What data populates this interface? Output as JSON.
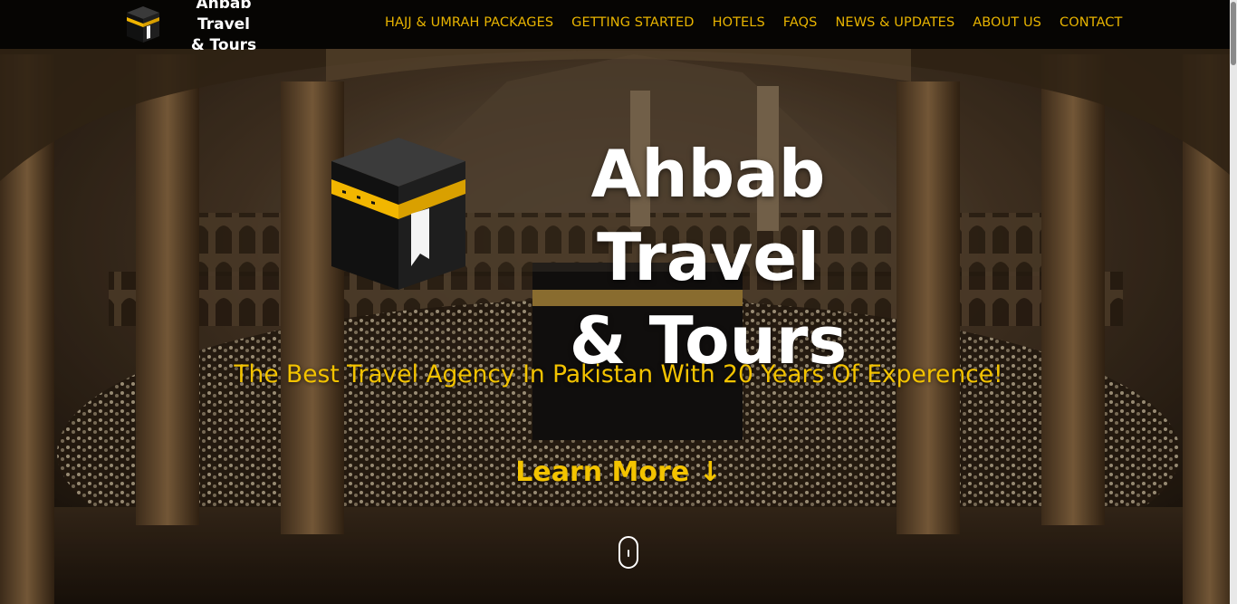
{
  "colors": {
    "accent": "#e8b400",
    "tagline": "#f3c300",
    "navbar_bg": "#060503",
    "title": "#ffffff"
  },
  "header": {
    "logo_icon": "kaaba-icon",
    "brand_line1": "Ahbab Travel",
    "brand_line2": "& Tours",
    "nav": [
      {
        "label": "HAJJ & UMRAH PACKAGES"
      },
      {
        "label": "GETTING STARTED"
      },
      {
        "label": "HOTELS"
      },
      {
        "label": "FAQS"
      },
      {
        "label": "NEWS & UPDATES"
      },
      {
        "label": "ABOUT US"
      },
      {
        "label": "CONTACT"
      }
    ]
  },
  "hero": {
    "logo_icon": "kaaba-icon",
    "title_line1": "Ahbab Travel",
    "title_line2": "& Tours",
    "tagline": "The Best Travel Agency In Pakistan With 20 Years Of Experence!",
    "cta": "Learn More ↓",
    "scroll_icon": "mouse-scroll-icon",
    "background": "masjid-al-haram-kaaba-image"
  }
}
